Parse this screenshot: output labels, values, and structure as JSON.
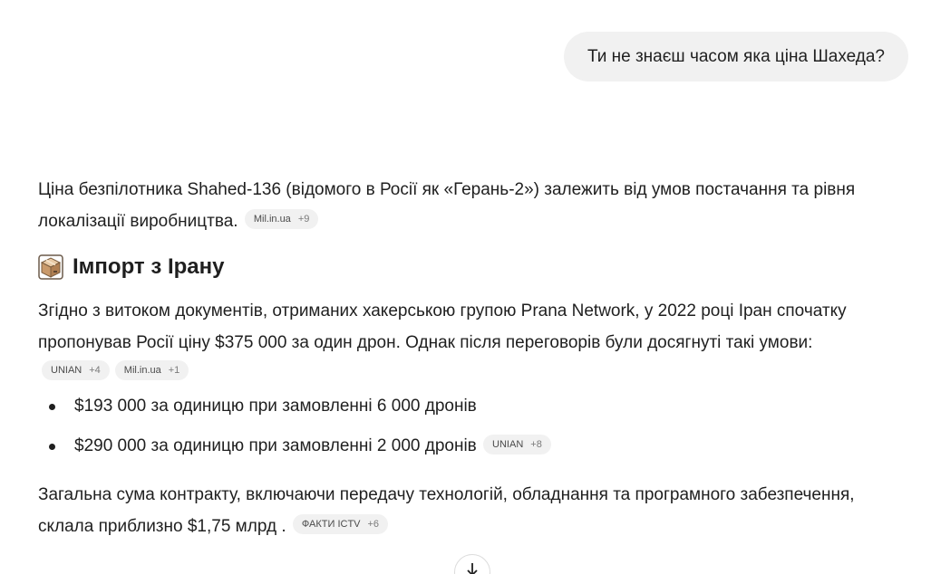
{
  "user_message": "Ти не знаєш часом яка ціна Шахеда?",
  "answer": {
    "intro": "Ціна безпілотника Shahed-136 (відомого в Росії як «Герань-2») залежить від умов постачання та рівня локалізації виробництва.",
    "intro_chip": {
      "source": "Mil.in.ua",
      "more": "+9"
    },
    "section_title": "Імпорт з Ірану",
    "section_icon": "package-box-icon",
    "leak_text": "Згідно з витоком документів, отриманих хакерською групою Prana Network, у 2022 році Іран спочатку пропонував Росії ціну $375 000 за один дрон. Однак після переговорів були досягнуті такі умови:",
    "leak_chips": [
      {
        "source": "UNIAN",
        "more": "+4"
      },
      {
        "source": "Mil.in.ua",
        "more": "+1"
      }
    ],
    "bullets": [
      {
        "text": "$193 000 за одиницю при замовленні 6 000 дронів"
      },
      {
        "text": "$290 000 за одиницю при замовленні 2 000 дронів",
        "chip": {
          "source": "UNIAN",
          "more": "+8"
        }
      }
    ],
    "total_text": "Загальна сума контракту, включаючи передачу технологій, обладнання та програмного забезпечення, склала приблизно $1,75 млрд .",
    "total_chip": {
      "source": "ФАКТИ ICTV",
      "more": "+6"
    }
  },
  "scroll_button_icon": "arrow-down-icon"
}
